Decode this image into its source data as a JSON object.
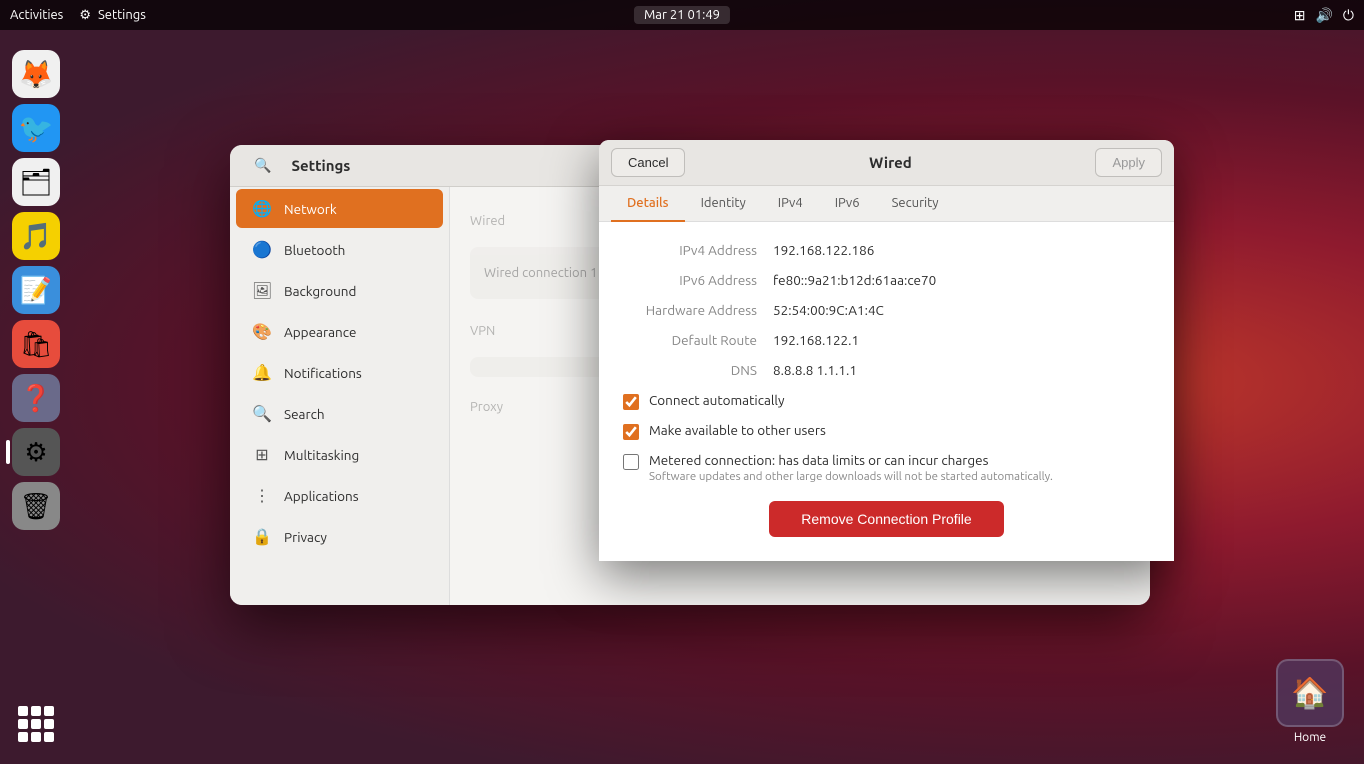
{
  "desktop": {
    "bg_desc": "Ubuntu desktop background red gradient"
  },
  "topbar": {
    "activities": "Activities",
    "settings_app": "Settings",
    "datetime": "Mar 21  01:49"
  },
  "dock": {
    "items": [
      {
        "id": "firefox",
        "icon": "🦊",
        "label": "Firefox",
        "active": false
      },
      {
        "id": "thunderbird",
        "icon": "🐦",
        "label": "Thunderbird",
        "active": false
      },
      {
        "id": "files",
        "icon": "🗂",
        "label": "Files",
        "active": false
      },
      {
        "id": "rhythmbox",
        "icon": "🎵",
        "label": "Rhythmbox",
        "active": false
      },
      {
        "id": "writer",
        "icon": "📝",
        "label": "Writer",
        "active": false
      },
      {
        "id": "software",
        "icon": "🛍",
        "label": "Software",
        "active": false
      },
      {
        "id": "help",
        "icon": "❓",
        "label": "Help",
        "active": false
      },
      {
        "id": "settings",
        "icon": "⚙",
        "label": "Settings",
        "active": true
      },
      {
        "id": "trash",
        "icon": "🗑",
        "label": "Trash",
        "active": false
      }
    ]
  },
  "settings": {
    "title": "Settings",
    "sidebar": {
      "items": [
        {
          "id": "network",
          "label": "Network",
          "icon": "🌐",
          "active": true
        },
        {
          "id": "bluetooth",
          "label": "Bluetooth",
          "icon": "🔵",
          "active": false
        },
        {
          "id": "background",
          "label": "Background",
          "icon": "🖼",
          "active": false
        },
        {
          "id": "appearance",
          "label": "Appearance",
          "icon": "🎨",
          "active": false
        },
        {
          "id": "notifications",
          "label": "Notifications",
          "icon": "🔔",
          "active": false
        },
        {
          "id": "search",
          "label": "Search",
          "icon": "🔍",
          "active": false
        },
        {
          "id": "multitasking",
          "label": "Multitasking",
          "icon": "⊞",
          "active": false
        },
        {
          "id": "applications",
          "label": "Applications",
          "icon": "⋮⋮",
          "active": false
        },
        {
          "id": "privacy",
          "label": "Privacy",
          "icon": "🔒",
          "active": false
        }
      ]
    }
  },
  "wired_dialog": {
    "title": "Wired",
    "cancel_label": "Cancel",
    "apply_label": "Apply",
    "tabs": [
      {
        "id": "details",
        "label": "Details",
        "active": true
      },
      {
        "id": "identity",
        "label": "Identity",
        "active": false
      },
      {
        "id": "ipv4",
        "label": "IPv4",
        "active": false
      },
      {
        "id": "ipv6",
        "label": "IPv6",
        "active": false
      },
      {
        "id": "security",
        "label": "Security",
        "active": false
      }
    ],
    "details": {
      "rows": [
        {
          "label": "IPv4 Address",
          "value": "192.168.122.186"
        },
        {
          "label": "IPv6 Address",
          "value": "fe80::9a21:b12d:61aa:ce70"
        },
        {
          "label": "Hardware Address",
          "value": "52:54:00:9C:A1:4C"
        },
        {
          "label": "Default Route",
          "value": "192.168.122.1"
        },
        {
          "label": "DNS",
          "value": "8.8.8.8  1.1.1.1"
        }
      ],
      "checkboxes": [
        {
          "id": "connect-auto",
          "label": "Connect automatically",
          "checked": true,
          "sublabel": ""
        },
        {
          "id": "available-users",
          "label": "Make available to other users",
          "checked": true,
          "sublabel": ""
        },
        {
          "id": "metered",
          "label": "Metered connection: has data limits or can incur charges",
          "checked": false,
          "sublabel": "Software updates and other large downloads will not be started automatically."
        }
      ],
      "remove_btn": "Remove Connection Profile"
    }
  },
  "home": {
    "label": "Home",
    "icon": "🏠"
  }
}
